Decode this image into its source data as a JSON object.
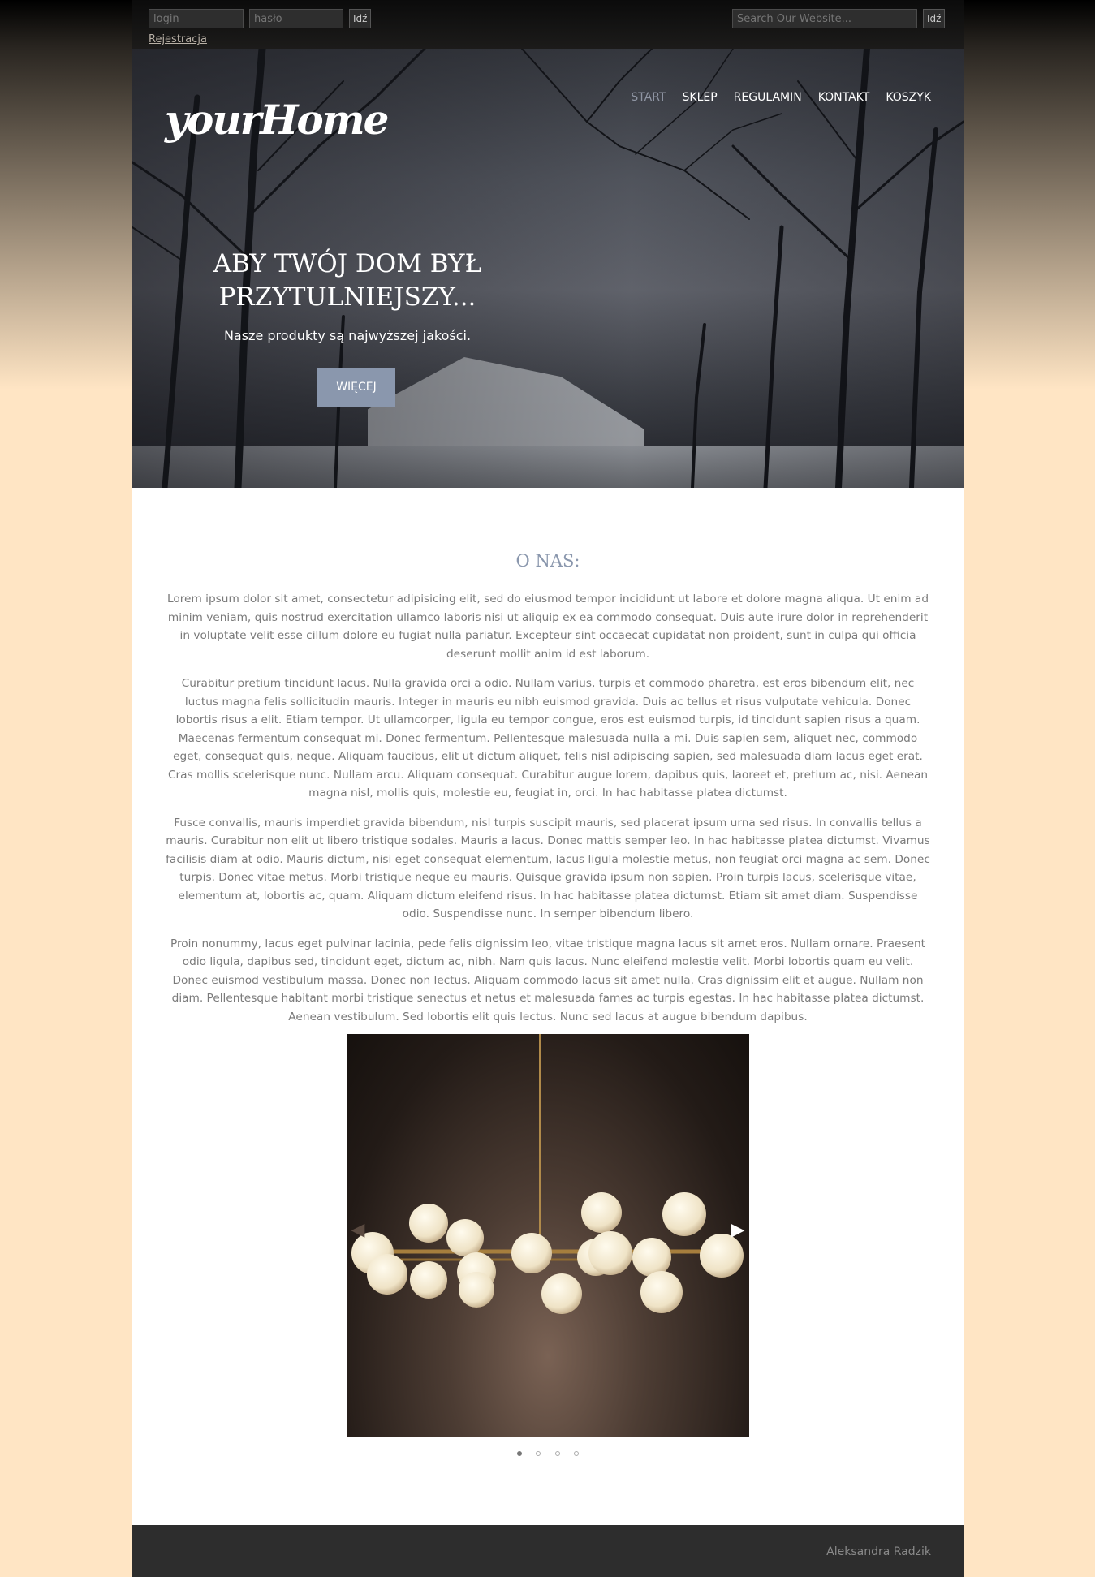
{
  "topbar": {
    "login_placeholder": "login",
    "password_placeholder": "hasło",
    "login_button": "Idź",
    "register_link": "Rejestracja",
    "search_placeholder": "Search Our Website...",
    "search_button": "Idź"
  },
  "brand": {
    "logo": "yourHome"
  },
  "nav": {
    "items": [
      "START",
      "SKLEP",
      "REGULAMIN",
      "KONTAKT",
      "KOSZYK"
    ],
    "active": "START"
  },
  "hero": {
    "title": "ABY TWÓJ DOM BYŁ PRZYTULNIEJSZY...",
    "subtitle": "Nasze produkty są najwyższej jakości.",
    "button": "WIĘCEJ"
  },
  "about": {
    "title": "O NAS:",
    "paragraphs": [
      "Lorem ipsum dolor sit amet, consectetur adipisicing elit, sed do eiusmod tempor incididunt ut labore et dolore magna aliqua. Ut enim ad minim veniam, quis nostrud exercitation ullamco laboris nisi ut aliquip ex ea commodo consequat. Duis aute irure dolor in reprehenderit in voluptate velit esse cillum dolore eu fugiat nulla pariatur. Excepteur sint occaecat cupidatat non proident, sunt in culpa qui officia deserunt mollit anim id est laborum.",
      "Curabitur pretium tincidunt lacus. Nulla gravida orci a odio. Nullam varius, turpis et commodo pharetra, est eros bibendum elit, nec luctus magna felis sollicitudin mauris. Integer in mauris eu nibh euismod gravida. Duis ac tellus et risus vulputate vehicula. Donec lobortis risus a elit. Etiam tempor. Ut ullamcorper, ligula eu tempor congue, eros est euismod turpis, id tincidunt sapien risus a quam. Maecenas fermentum consequat mi. Donec fermentum. Pellentesque malesuada nulla a mi. Duis sapien sem, aliquet nec, commodo eget, consequat quis, neque. Aliquam faucibus, elit ut dictum aliquet, felis nisl adipiscing sapien, sed malesuada diam lacus eget erat. Cras mollis scelerisque nunc. Nullam arcu. Aliquam consequat. Curabitur augue lorem, dapibus quis, laoreet et, pretium ac, nisi. Aenean magna nisl, mollis quis, molestie eu, feugiat in, orci. In hac habitasse platea dictumst.",
      "Fusce convallis, mauris imperdiet gravida bibendum, nisl turpis suscipit mauris, sed placerat ipsum urna sed risus. In convallis tellus a mauris. Curabitur non elit ut libero tristique sodales. Mauris a lacus. Donec mattis semper leo. In hac habitasse platea dictumst. Vivamus facilisis diam at odio. Mauris dictum, nisi eget consequat elementum, lacus ligula molestie metus, non feugiat orci magna ac sem. Donec turpis. Donec vitae metus. Morbi tristique neque eu mauris. Quisque gravida ipsum non sapien. Proin turpis lacus, scelerisque vitae, elementum at, lobortis ac, quam. Aliquam dictum eleifend risus. In hac habitasse platea dictumst. Etiam sit amet diam. Suspendisse odio. Suspendisse nunc. In semper bibendum libero.",
      "Proin nonummy, lacus eget pulvinar lacinia, pede felis dignissim leo, vitae tristique magna lacus sit amet eros. Nullam ornare. Praesent odio ligula, dapibus sed, tincidunt eget, dictum ac, nibh. Nam quis lacus. Nunc eleifend molestie velit. Morbi lobortis quam eu velit. Donec euismod vestibulum massa. Donec non lectus. Aliquam commodo lacus sit amet nulla. Cras dignissim elit et augue. Nullam non diam. Pellentesque habitant morbi tristique senectus et netus et malesuada fames ac turpis egestas. In hac habitasse platea dictumst. Aenean vestibulum. Sed lobortis elit quis lectus. Nunc sed lacus at augue bibendum dapibus."
    ]
  },
  "slider": {
    "prev_icon": "arrow-left-icon",
    "next_icon": "arrow-right-icon",
    "slide_count": 4,
    "active_slide": 1
  },
  "footer": {
    "author": "Aleksandra Radzik"
  },
  "colors": {
    "accent": "#8a97ad",
    "page_bg": "#ffe5c4",
    "footer_bg": "#2d2d2d",
    "text": "#7a7a7a"
  }
}
